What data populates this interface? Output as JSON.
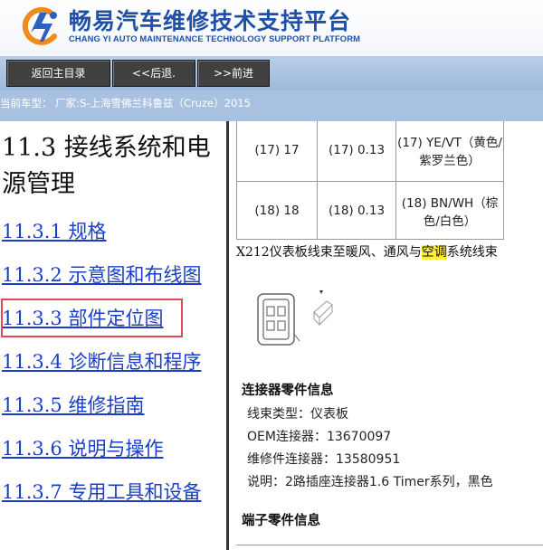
{
  "brand": {
    "name_cn": "畅易汽车维修技术支持平台",
    "name_en": "CHANG YI AUTO MAINTENANCE TECHNOLOGY SUPPORT PLATFORM",
    "accent_color": "#1f4fa8",
    "logo_icon": "cy-logo-icon"
  },
  "toolbar": {
    "home_label": "返回主目录",
    "back_label": "<<后退.",
    "forward_label": ">>前进"
  },
  "vehicle_label": "当前车型： 厂家:S-上海雪佛兰科鲁兹（Cruze）2015",
  "nav": {
    "title": "11.3 接线系统和电源管理",
    "items": [
      {
        "label": "11.3.1 规格"
      },
      {
        "label": "11.3.2 示意图和布线图"
      },
      {
        "label": "11.3.3 部件定位图"
      },
      {
        "label": "11.3.4 诊断信息和程序"
      },
      {
        "label": "11.3.5 维修指南"
      },
      {
        "label": "11.3.6 说明与操作"
      },
      {
        "label": "11.3.7 专用工具和设备"
      }
    ],
    "active_index": 2,
    "active_color": "#e04a57"
  },
  "pin_table": {
    "rows": [
      {
        "pin": "(17) 17",
        "size": "(17) 0.13",
        "color": "(17) YE/VT（黄色/紫罗兰色）"
      },
      {
        "pin": "(18) 18",
        "size": "(18) 0.13",
        "color": "(18) BN/WH（棕色/白色）"
      }
    ]
  },
  "connector": {
    "title_pre": "X212仪表板线束至暖风、通风与",
    "title_hl": "空调",
    "title_post": "系统线束",
    "info_heading": "连接器零件信息",
    "harness_type": "线束类型：仪表板",
    "oem": "OEM连接器：13670097",
    "service": "维修件连接器：13580951",
    "description": "说明：2路插座连接器1.6 Timer系列，黑色",
    "terminal_heading": "端子零件信息"
  }
}
